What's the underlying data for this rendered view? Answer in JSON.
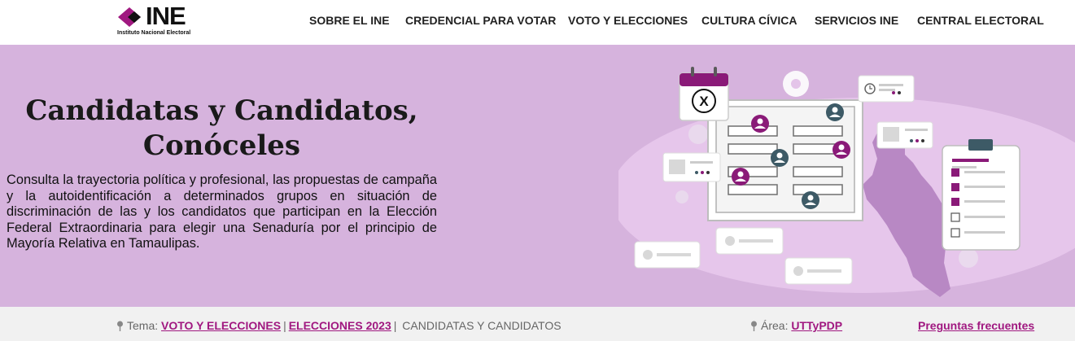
{
  "header": {
    "logo_text": "INE",
    "logo_subtitle": "Instituto Nacional Electoral",
    "nav": [
      {
        "label": "SOBRE EL INE"
      },
      {
        "label": "CREDENCIAL PARA VOTAR"
      },
      {
        "label": "VOTO Y ELECCIONES"
      },
      {
        "label": "CULTURA CÍVICA"
      },
      {
        "label": "SERVICIOS INE"
      },
      {
        "label": "CENTRAL ELECTORAL"
      }
    ]
  },
  "hero": {
    "title_line1": "Candidatas y Candidatos,",
    "title_line2": "Conóceles",
    "description": "Consulta la trayectoria política y profesional, las propuestas de campaña y la autoidentificación a determinados grupos en situación de discriminación de las y los candidatos que participan en la Elección Federal Extraordinaria para elegir una Senaduría por el principio de Mayoría Relativa en Tamaulipas.",
    "illustration_ballot_mark": "X"
  },
  "breadcrumb": {
    "tema_label": "Tema:",
    "links": [
      "VOTO Y ELECCIONES",
      "ELECCIONES 2023"
    ],
    "current": "CANDIDATAS Y CANDIDATOS",
    "area_label": "Área:",
    "area_link": "UTTyPDP",
    "faq_link": "Preguntas frecuentes"
  },
  "colors": {
    "brand": "#a01880",
    "hero_bg": "#d6b3dd",
    "dark_teal": "#3d5a66"
  }
}
